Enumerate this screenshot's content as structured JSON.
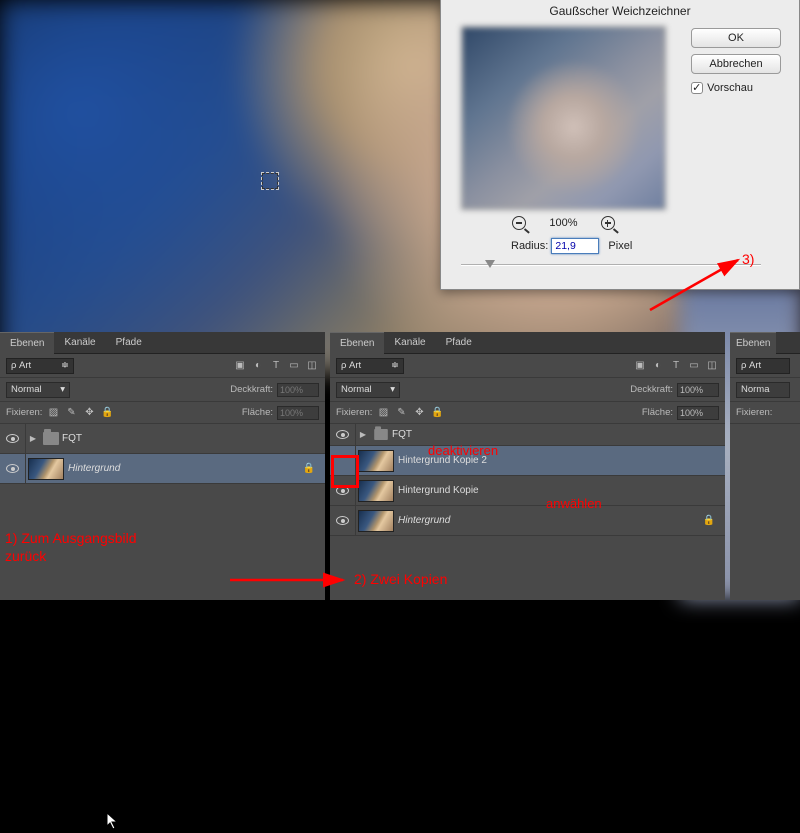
{
  "dialog": {
    "title": "Gaußscher Weichzeichner",
    "ok": "OK",
    "cancel": "Abbrechen",
    "preview": "Vorschau",
    "zoom": "100%",
    "radius_label": "Radius:",
    "radius_value": "21,9",
    "unit": "Pixel"
  },
  "panel": {
    "tabs": [
      "Ebenen",
      "Kanäle",
      "Pfade"
    ],
    "kind_label": "Art",
    "blend": "Normal",
    "opacity_label": "Deckkraft:",
    "opacity_value": "100%",
    "lock_label": "Fixieren:",
    "fill_label": "Fläche:",
    "fill_value": "100%"
  },
  "panel1": {
    "layers": [
      {
        "name": "FQT",
        "folder": true
      },
      {
        "name": "Hintergrund",
        "locked": true,
        "active": true
      }
    ]
  },
  "panel2": {
    "layers": [
      {
        "name": "FQT",
        "folder": true
      },
      {
        "name": "Hintergrund Kopie 2",
        "active": true,
        "eyeoff": true
      },
      {
        "name": "Hintergrund Kopie"
      },
      {
        "name": "Hintergrund",
        "locked": true
      }
    ]
  },
  "annotations": {
    "a1_line1": "1) Zum Ausgangsbild",
    "a1_line2": "zurück",
    "a2": "2) Zwei Kopien",
    "a3": "3)",
    "deact": "deaktivieren",
    "select": "anwählen"
  }
}
